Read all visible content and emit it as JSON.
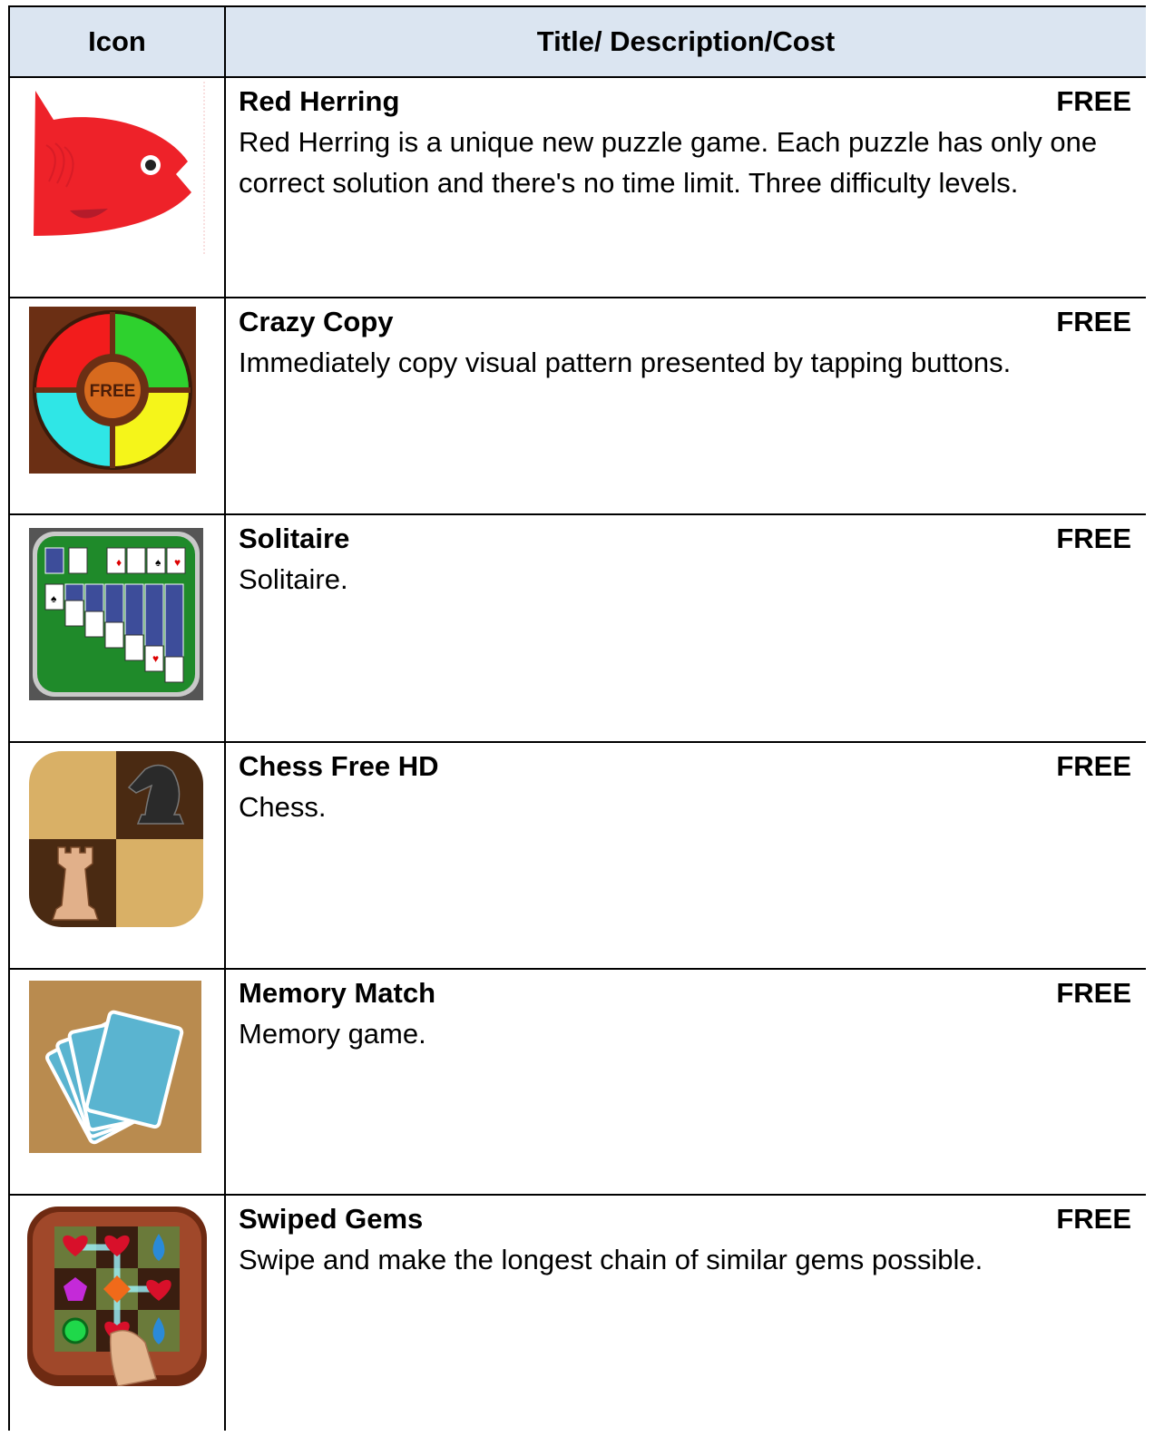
{
  "table": {
    "headers": {
      "icon": "Icon",
      "details": "Title/ Description/Cost"
    },
    "rows": [
      {
        "title": "Red Herring",
        "cost": "FREE",
        "description": "Red Herring is a unique new puzzle game.  Each puzzle has only one correct solution and there's no time limit.  Three difficulty levels.",
        "icon": "red-fish-icon"
      },
      {
        "title": "Crazy Copy",
        "cost": "FREE",
        "description": "Immediately copy visual pattern presented by tapping buttons.",
        "icon": "color-wheel-icon",
        "icon_text": "FREE"
      },
      {
        "title": "Solitaire",
        "cost": "FREE",
        "description": "Solitaire.",
        "icon": "solitaire-cards-icon"
      },
      {
        "title": "Chess Free HD",
        "cost": "FREE",
        "description": "Chess.",
        "icon": "chess-board-icon"
      },
      {
        "title": "Memory Match",
        "cost": "FREE",
        "description": "Memory game.",
        "icon": "memory-cards-icon"
      },
      {
        "title": "Swiped Gems",
        "cost": "FREE",
        "description": "Swipe and make the longest chain of similar gems possible.",
        "icon": "gems-grid-icon"
      }
    ]
  },
  "colors": {
    "header_bg": "#dbe5f1",
    "border": "#000000"
  }
}
